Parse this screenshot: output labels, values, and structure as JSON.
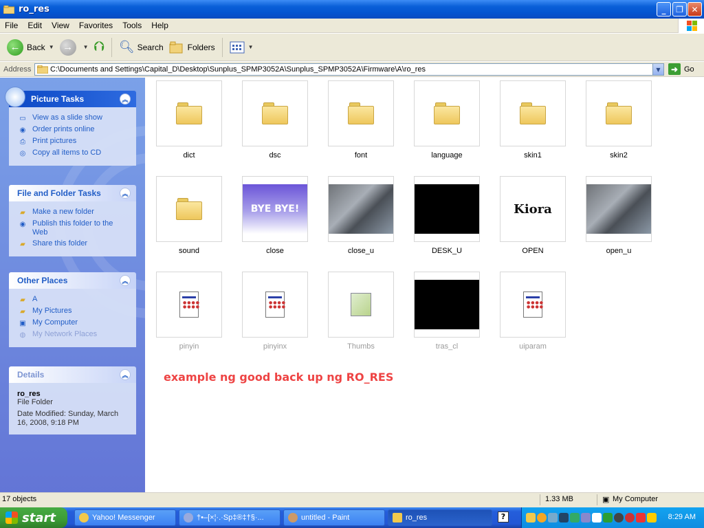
{
  "window": {
    "title": "ro_res"
  },
  "menu": [
    "File",
    "Edit",
    "View",
    "Favorites",
    "Tools",
    "Help"
  ],
  "toolbar": {
    "back": "Back",
    "search": "Search",
    "folders": "Folders"
  },
  "address": {
    "label": "Address",
    "path": "C:\\Documents and Settings\\Capital_D\\Desktop\\Sunplus_SPMP3052A\\Sunplus_SPMP3052A\\Firmware\\A\\ro_res",
    "go": "Go"
  },
  "taskpane": {
    "picture_tasks": {
      "title": "Picture Tasks",
      "items": [
        "View as a slide show",
        "Order prints online",
        "Print pictures",
        "Copy all items to CD"
      ]
    },
    "file_folder_tasks": {
      "title": "File and Folder Tasks",
      "items": [
        "Make a new folder",
        "Publish this folder to the Web",
        "Share this folder"
      ]
    },
    "other_places": {
      "title": "Other Places",
      "items": [
        "A",
        "My Pictures",
        "My Computer",
        "My Network Places"
      ]
    },
    "details": {
      "title": "Details",
      "name": "ro_res",
      "type": "File Folder",
      "modified": "Date Modified: Sunday, March 16, 2008, 9:18 PM"
    }
  },
  "files": [
    {
      "name": "dict",
      "kind": "folder"
    },
    {
      "name": "dsc",
      "kind": "folder"
    },
    {
      "name": "font",
      "kind": "folder"
    },
    {
      "name": "language",
      "kind": "folder"
    },
    {
      "name": "skin1",
      "kind": "folder"
    },
    {
      "name": "skin2",
      "kind": "folder"
    },
    {
      "name": "sound",
      "kind": "folder"
    },
    {
      "name": "close",
      "kind": "image",
      "thumb_text": "BYE BYE!"
    },
    {
      "name": "close_u",
      "kind": "photo"
    },
    {
      "name": "DESK_U",
      "kind": "black"
    },
    {
      "name": "OPEN",
      "kind": "image",
      "thumb_text": "Kiora"
    },
    {
      "name": "open_u",
      "kind": "photo"
    },
    {
      "name": "pinyin",
      "kind": "document"
    },
    {
      "name": "pinyinx",
      "kind": "document"
    },
    {
      "name": "Thumbs",
      "kind": "thumbs"
    },
    {
      "name": "tras_cl",
      "kind": "black"
    },
    {
      "name": "uiparam",
      "kind": "document"
    }
  ],
  "annotation": "example ng good back up ng RO_RES",
  "statusbar": {
    "objects": "17 objects",
    "size": "1.33 MB",
    "location": "My Computer"
  },
  "taskbar": {
    "start": "start",
    "buttons": [
      "Yahoo! Messenger",
      "†•–[×¦·.·Sp‡®‡†§·...",
      "untitled - Paint",
      "ro_res"
    ],
    "help": "?",
    "clock": "8:29 AM"
  },
  "colors": {
    "accent": "#0a5fd8",
    "link": "#215dc6",
    "annotation": "#e44444"
  }
}
